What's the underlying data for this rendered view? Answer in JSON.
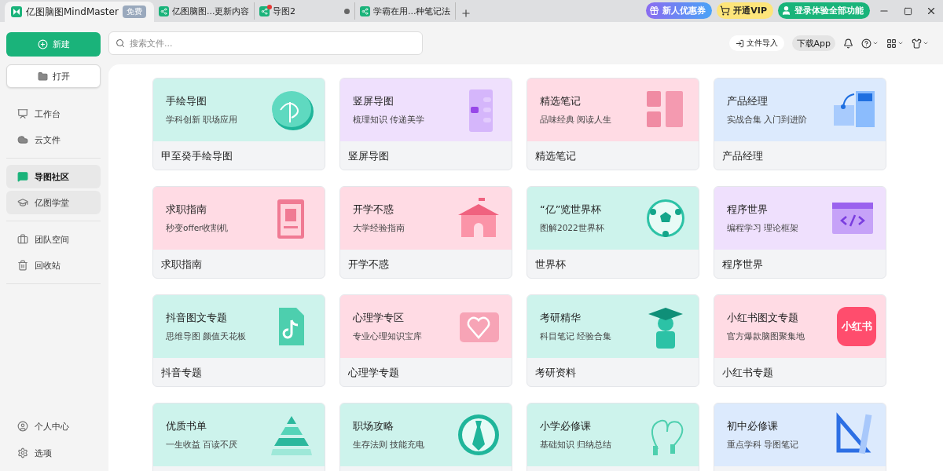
{
  "app": {
    "name": "亿图脑图MindMaster",
    "badge": "免费"
  },
  "tabs": [
    {
      "label": "亿图脑图...更新内容",
      "selected": false,
      "pinned": false
    },
    {
      "label": "导图2",
      "selected": false,
      "pinned": true
    },
    {
      "label": "学霸在用...种笔记法",
      "selected": false,
      "pinned": false
    }
  ],
  "promos": [
    {
      "kind": "coupon",
      "label": "新人优惠券"
    },
    {
      "kind": "vip",
      "label": "开通VIP"
    },
    {
      "kind": "login",
      "label": "登录体验全部功能"
    }
  ],
  "toolbar": {
    "search_placeholder": "搜索文件...",
    "import_label": "文件导入",
    "download_label": "下载App"
  },
  "sidebar": {
    "new_label": "新建",
    "open_label": "打开",
    "groups": [
      [
        {
          "kind": "workbench",
          "label": "工作台",
          "selected": false,
          "hovered": false
        },
        {
          "kind": "cloud",
          "label": "云文件",
          "selected": false,
          "hovered": false
        }
      ],
      [
        {
          "kind": "community",
          "label": "导图社区",
          "selected": true,
          "hovered": false
        },
        {
          "kind": "academy",
          "label": "亿图学堂",
          "selected": false,
          "hovered": true
        }
      ],
      [
        {
          "kind": "team",
          "label": "团队空间",
          "selected": false,
          "hovered": false
        },
        {
          "kind": "trash",
          "label": "回收站",
          "selected": false,
          "hovered": false
        }
      ]
    ],
    "bottom": [
      {
        "kind": "profile",
        "label": "个人中心",
        "selected": false,
        "hovered": false
      },
      {
        "kind": "options",
        "label": "选项",
        "selected": false,
        "hovered": false
      }
    ]
  },
  "cards": [
    {
      "title": "手绘导图",
      "subtitle": "学科创新 职场应用",
      "caption": "甲至癸手绘导图",
      "color": "#cdf3ec",
      "kind": "coin"
    },
    {
      "title": "竖屏导图",
      "subtitle": "梳理知识 传递美学",
      "caption": "竖屏导图",
      "color": "#efe0fd",
      "kind": "phone"
    },
    {
      "title": "精选笔记",
      "subtitle": "品味经典 阅读人生",
      "caption": "精选笔记",
      "color": "#ffdbe4",
      "kind": "notes"
    },
    {
      "title": "产品经理",
      "subtitle": "实战合集 入门到进阶",
      "caption": "产品经理",
      "color": "#dceafd",
      "kind": "flow"
    },
    {
      "title": "求职指南",
      "subtitle": "秒变offer收割机",
      "caption": "求职指南",
      "color": "#ffdbe4",
      "kind": "badge"
    },
    {
      "title": "开学不惑",
      "subtitle": "大学经验指南",
      "caption": "开学不惑",
      "color": "#ffdbe4",
      "kind": "house"
    },
    {
      "title": "“亿”览世界杯",
      "subtitle": "图解2022世界杯",
      "caption": "世界杯",
      "color": "#cdf3ec",
      "kind": "ball"
    },
    {
      "title": "程序世界",
      "subtitle": "编程学习 理论框架",
      "caption": "程序世界",
      "color": "#efe0fd",
      "kind": "code"
    },
    {
      "title": "抖音图文专题",
      "subtitle": "思维导图 颜值天花板",
      "caption": "抖音专题",
      "color": "#cdf3ec",
      "kind": "note"
    },
    {
      "title": "心理学专区",
      "subtitle": "专业心理知识宝库",
      "caption": "心理学专题",
      "color": "#ffdbe4",
      "kind": "heart"
    },
    {
      "title": "考研精华",
      "subtitle": "科目笔记 经验合集",
      "caption": "考研资料",
      "color": "#cdf3ec",
      "kind": "grad"
    },
    {
      "title": "小红书图文专题",
      "subtitle": "官方爆款脑图聚集地",
      "caption": "小红书专题",
      "color": "#ffdbe4",
      "kind": "logo",
      "logo_text": "小红书"
    },
    {
      "title": "优质书单",
      "subtitle": "一生收益 百读不厌",
      "color": "#cdf3ec",
      "kind": "pyramid"
    },
    {
      "title": "职场攻略",
      "subtitle": "生存法则 技能充电",
      "color": "#cdf3ec",
      "kind": "tie"
    },
    {
      "title": "小学必修课",
      "subtitle": "基础知识 归纳总结",
      "color": "#cdf3ec",
      "kind": "rope"
    },
    {
      "title": "初中必修课",
      "subtitle": "重点学科 导图笔记",
      "color": "#dceafd",
      "kind": "ruler"
    }
  ]
}
